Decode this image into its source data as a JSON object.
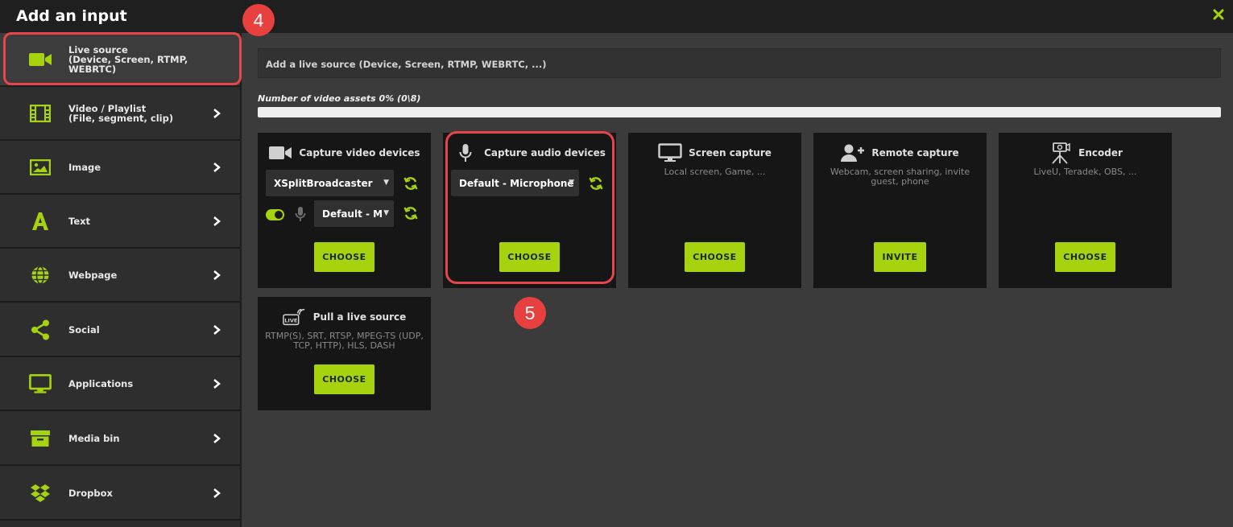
{
  "window": {
    "title": "Add an input",
    "accent": "#a6d30e"
  },
  "sidebar": {
    "items": [
      {
        "label": "Live source\n(Device, Screen, RTMP,\nWEBRTC)",
        "icon": "video-camera-icon"
      },
      {
        "label": "Video / Playlist\n(File, segment, clip)",
        "icon": "film-icon"
      },
      {
        "label": "Image",
        "icon": "image-icon"
      },
      {
        "label": "Text",
        "icon": "text-icon"
      },
      {
        "label": "Webpage",
        "icon": "globe-icon"
      },
      {
        "label": "Social",
        "icon": "share-icon"
      },
      {
        "label": "Applications",
        "icon": "monitor-icon"
      },
      {
        "label": "Media bin",
        "icon": "archive-icon"
      },
      {
        "label": "Dropbox",
        "icon": "dropbox-icon"
      }
    ]
  },
  "annotations": {
    "step4": "4",
    "step5": "5"
  },
  "main": {
    "search_placeholder": "Add a live source (Device, Screen, RTMP, WEBRTC, ...)",
    "assets_label": "Number of video assets 0% (0\\8)",
    "assets_progress": 0
  },
  "cards": {
    "video": {
      "title": "Capture video devices",
      "device": "XSplitBroadcaster",
      "audio": "Default - M",
      "button": "CHOOSE"
    },
    "audio": {
      "title": "Capture audio devices",
      "device": "Default - Microphone",
      "button": "CHOOSE"
    },
    "screen": {
      "title": "Screen capture",
      "desc": "Local screen, Game, ...",
      "button": "CHOOSE"
    },
    "remote": {
      "title": "Remote capture",
      "desc": "Webcam, screen sharing, invite guest, phone",
      "button": "INVITE"
    },
    "encoder": {
      "title": "Encoder",
      "desc": "LiveU, Teradek, OBS, ...",
      "button": "CHOOSE"
    },
    "pull": {
      "title": "Pull a live source",
      "desc": "RTMP(S), SRT, RTSP, MPEG-TS (UDP, TCP, HTTP), HLS, DASH",
      "button": "CHOOSE"
    }
  }
}
